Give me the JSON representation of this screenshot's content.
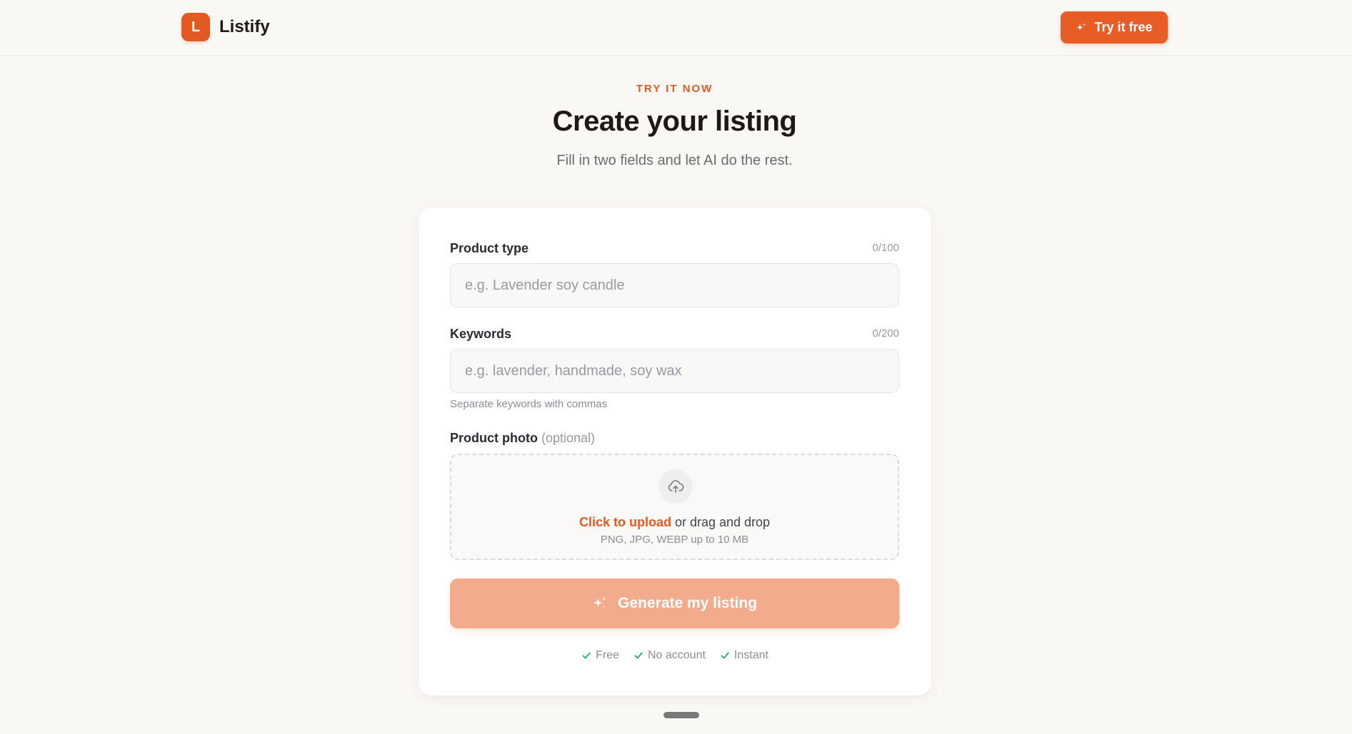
{
  "header": {
    "logo_letter": "L",
    "brand": "Listify",
    "cta_label": "Try it free"
  },
  "hero": {
    "eyebrow": "TRY IT NOW",
    "title": "Create your listing",
    "subtitle": "Fill in two fields and let AI do the rest."
  },
  "form": {
    "product_type": {
      "label": "Product type",
      "counter": "0/100",
      "value": "",
      "placeholder": "e.g. Lavender soy candle"
    },
    "keywords": {
      "label": "Keywords",
      "counter": "0/200",
      "value": "",
      "placeholder": "e.g. lavender, handmade, soy wax",
      "hint": "Separate keywords with commas"
    },
    "photo": {
      "label": "Product photo",
      "optional": "(optional)",
      "upload_link": "Click to upload",
      "upload_rest": " or drag and drop",
      "formats": "PNG, JPG, WEBP up to 10 MB",
      "icon": "upload-cloud-icon"
    },
    "generate_label": "Generate my listing",
    "perks": [
      "Free",
      "No account",
      "Instant"
    ]
  },
  "colors": {
    "accent": "#e85d25",
    "accent_disabled": "#f3ab8d",
    "check": "#22a865"
  }
}
